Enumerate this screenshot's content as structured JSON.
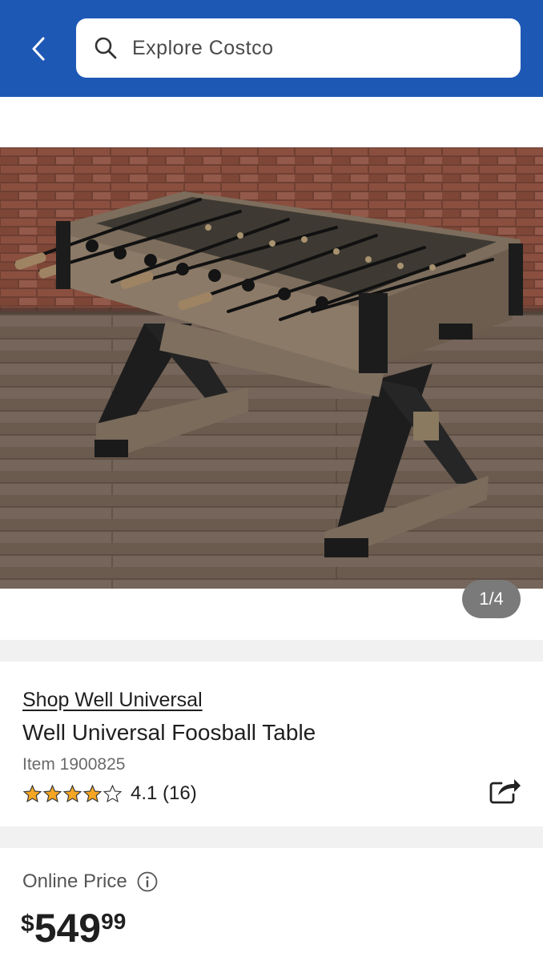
{
  "header": {
    "search_placeholder": "Explore Costco",
    "colors": {
      "bar": "#1e58b5"
    }
  },
  "gallery": {
    "page_indicator": "1/4"
  },
  "product": {
    "brand_link": "Shop Well Universal",
    "title": "Well Universal Foosball Table",
    "item_number": "Item 1900825",
    "rating": {
      "stars": 4,
      "max_stars": 5,
      "text": "4.1 (16)"
    }
  },
  "pricing": {
    "label": "Online Price",
    "currency": "$",
    "dollars": "549",
    "cents": "99"
  }
}
